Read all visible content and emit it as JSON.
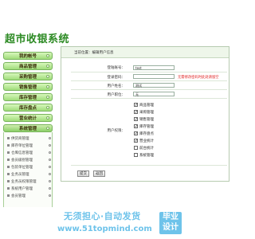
{
  "app": {
    "title": "超市收银系统"
  },
  "sidebar": {
    "menu": [
      {
        "label": "我的帐号"
      },
      {
        "label": "商品管理"
      },
      {
        "label": "采购管理"
      },
      {
        "label": "销售管理"
      },
      {
        "label": "库存管理"
      },
      {
        "label": "库存盘点"
      },
      {
        "label": "营业统计"
      },
      {
        "label": "系统管理"
      }
    ],
    "sub_items": [
      {
        "label": "供货商管理"
      },
      {
        "label": "库存单位管理"
      },
      {
        "label": "仓库信息管理"
      },
      {
        "label": "会员级别管理"
      },
      {
        "label": "包装单位管理"
      },
      {
        "label": "业务员管理"
      },
      {
        "label": "业务员权限管理"
      },
      {
        "label": "系统用户管理"
      },
      {
        "label": "会员管理"
      }
    ]
  },
  "main": {
    "location": "当前位置：编辑用户信息",
    "form": {
      "username_label": "登陆账号：",
      "username_value": "test",
      "password_label": "登录密码：",
      "password_value": "",
      "password_error": "无需修改密码时此处请留空",
      "name_label": "用户姓名：",
      "name_value": "测试",
      "role_label": "用户职位：",
      "role_value": "无",
      "perm_label": "用户权限：",
      "permissions": [
        {
          "label": "商品管理",
          "checked": true
        },
        {
          "label": "采购管理",
          "checked": true
        },
        {
          "label": "销售管理",
          "checked": true
        },
        {
          "label": "库存管理",
          "checked": true
        },
        {
          "label": "库存盘点",
          "checked": true
        },
        {
          "label": "营业统计",
          "checked": true
        },
        {
          "label": "前台统计",
          "checked": false
        },
        {
          "label": "系统管理",
          "checked": false
        }
      ]
    },
    "buttons": {
      "submit": "提交",
      "back": "返回"
    }
  },
  "banner": {
    "slogan": "无须担心·自动发货",
    "url": "www.51topmind.com",
    "badge_line1": "毕业",
    "badge_line2": "设计"
  }
}
